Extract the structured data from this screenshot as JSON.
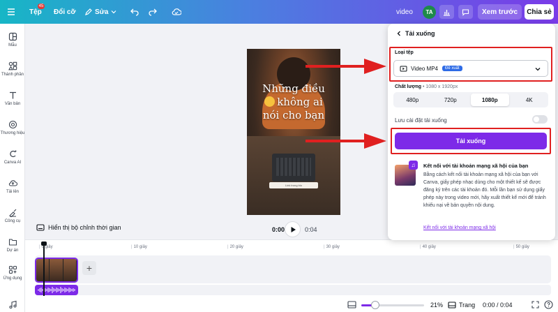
{
  "topbar": {
    "file": "Tệp",
    "file_badge": "45",
    "font": "Đổi cỡ",
    "edit": "Sửa",
    "doc_title": "video",
    "avatar": "TA",
    "preview": "Xem trước",
    "share": "Chia sẻ"
  },
  "sidebar": {
    "items": [
      {
        "label": "Mẫu",
        "icon": "template-icon"
      },
      {
        "label": "Thành phần",
        "icon": "elements-icon"
      },
      {
        "label": "Văn bản",
        "icon": "text-icon"
      },
      {
        "label": "Thương hiệu",
        "icon": "brand-icon"
      },
      {
        "label": "Canva AI",
        "icon": "ai-icon"
      },
      {
        "label": "Tải lên",
        "icon": "upload-icon"
      },
      {
        "label": "Công cụ",
        "icon": "tools-icon"
      },
      {
        "label": "Dự án",
        "icon": "projects-icon"
      },
      {
        "label": "Ứng dụng",
        "icon": "apps-icon"
      }
    ]
  },
  "design": {
    "headline_1": "Những điều",
    "headline_2": "không ai",
    "headline_3": "nói cho bạn",
    "pill_text": "Link trong bio"
  },
  "player": {
    "show_timer": "Hiển thị bộ chỉnh thời gian",
    "current_time": "0:00",
    "end_time": "0:04"
  },
  "timeline": {
    "ticks": [
      "0 giây",
      "10 giây",
      "20 giây",
      "30 giây",
      "40 giây",
      "50 giây"
    ]
  },
  "bottom": {
    "zoom": "21%",
    "zoom_level": 0.21,
    "pages": "Trang",
    "time": "0:00 / 0:04"
  },
  "panel": {
    "title": "Tải xuống",
    "file_type_label": "Loại tệp",
    "file_type_value": "Video MP4",
    "recommended": "Đề xuất",
    "quality_label": "Chất lượng",
    "quality_dims": "1080 x 1920px",
    "quality_options": [
      "480p",
      "720p",
      "1080p",
      "4K"
    ],
    "quality_selected": "1080p",
    "save_settings": "Lưu cài đặt tải xuống",
    "download_button": "Tải xuống",
    "social_title": "Kết nối với tài khoản mạng xã hội của bạn",
    "social_body": "Bằng cách kết nối tài khoản mạng xã hội của bạn với Canva, giấy phép nhạc dùng cho một thiết kế sẽ được đăng ký trên các tài khoản đó. Mỗi lần bạn sử dụng giấy phép này trong video mới, hãy xuất thiết kế mới để tránh khiếu nại về bản quyền nội dung.",
    "social_link": "Kết nối với tài khoản mạng xã hội"
  },
  "colors": {
    "accent": "#7d2ae8",
    "annotation": "#e02020",
    "recommended_badge": "#2e6be6"
  }
}
